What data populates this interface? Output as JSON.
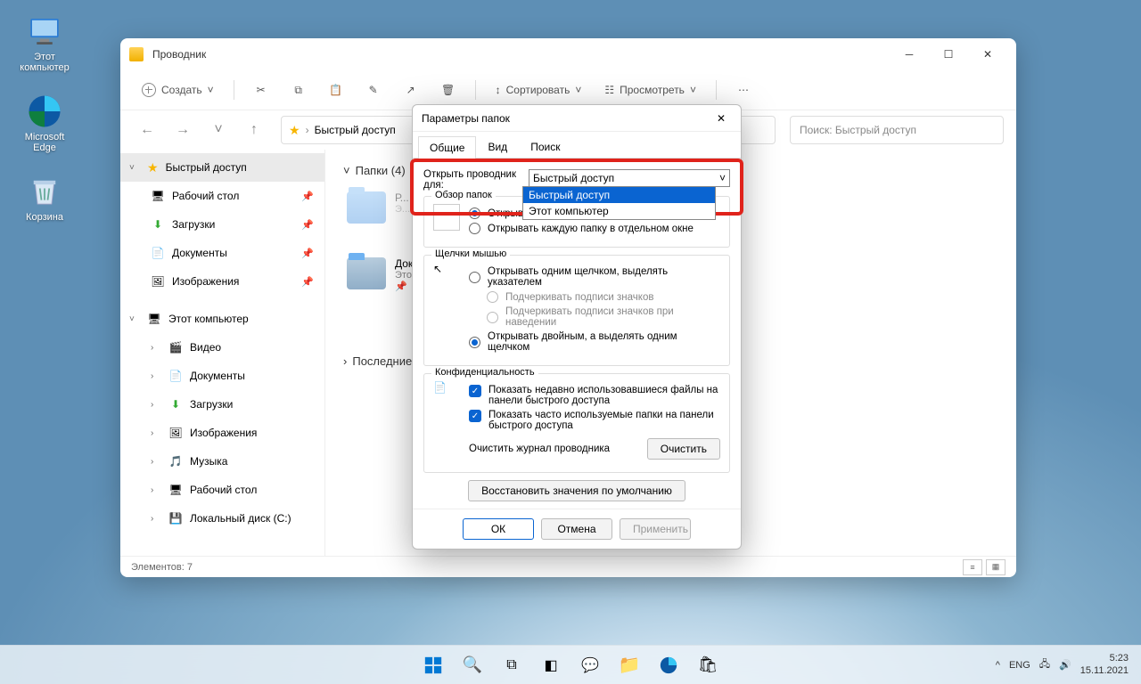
{
  "desktop": {
    "icons": [
      {
        "name": "this-pc",
        "label": "Этот\nкомпьютер"
      },
      {
        "name": "edge",
        "label": "Microsoft\nEdge"
      },
      {
        "name": "recycle-bin",
        "label": "Корзина"
      }
    ]
  },
  "explorer": {
    "title": "Проводник",
    "toolbar": {
      "new_label": "Создать",
      "sort_label": "Сортировать",
      "view_label": "Просмотреть"
    },
    "breadcrumb": "Быстрый доступ",
    "search_placeholder": "Поиск: Быстрый доступ",
    "sidebar": {
      "quick_access": "Быстрый доступ",
      "quick_items": [
        {
          "label": "Рабочий стол",
          "icon": "desktop"
        },
        {
          "label": "Загрузки",
          "icon": "downloads"
        },
        {
          "label": "Документы",
          "icon": "documents"
        },
        {
          "label": "Изображения",
          "icon": "pictures"
        }
      ],
      "this_pc": "Этот компьютер",
      "pc_items": [
        {
          "label": "Видео",
          "icon": "videos"
        },
        {
          "label": "Документы",
          "icon": "documents"
        },
        {
          "label": "Загрузки",
          "icon": "downloads"
        },
        {
          "label": "Изображения",
          "icon": "pictures"
        },
        {
          "label": "Музыка",
          "icon": "music"
        },
        {
          "label": "Рабочий стол",
          "icon": "desktop"
        },
        {
          "label": "Локальный диск (C:)",
          "icon": "disk"
        }
      ]
    },
    "content": {
      "folders_header": "Папки (4)",
      "recent_header": "Последние",
      "visible_card": {
        "name": "Документы",
        "sub": "Этот компьютер"
      }
    },
    "status": "Элементов: 7"
  },
  "dialog": {
    "title": "Параметры папок",
    "tabs": [
      "Общие",
      "Вид",
      "Поиск"
    ],
    "open_for_label": "Открыть проводник для:",
    "open_for_value": "Быстрый доступ",
    "open_for_options": [
      "Быстрый доступ",
      "Этот компьютер"
    ],
    "browse_folders": {
      "legend": "Обзор папок",
      "opt_same": "Открывать каждую папку в отдельном окне"
    },
    "clicks": {
      "legend": "Щелчки мышью",
      "single": "Открывать одним щелчком, выделять указателем",
      "underline_always": "Подчеркивать подписи значков",
      "underline_hover": "Подчеркивать подписи значков при наведении",
      "double": "Открывать двойным, а выделять одним щелчком"
    },
    "privacy": {
      "legend": "Конфиденциальность",
      "recent_files": "Показать недавно использовавшиеся файлы на панели быстрого доступа",
      "frequent_folders": "Показать часто используемые папки на панели быстрого доступа",
      "clear_history_label": "Очистить журнал проводника",
      "clear_btn": "Очистить"
    },
    "restore_defaults": "Восстановить значения по умолчанию",
    "ok": "ОК",
    "cancel": "Отмена",
    "apply": "Применить"
  },
  "taskbar": {
    "lang": "ENG",
    "time": "5:23",
    "date": "15.11.2021"
  }
}
